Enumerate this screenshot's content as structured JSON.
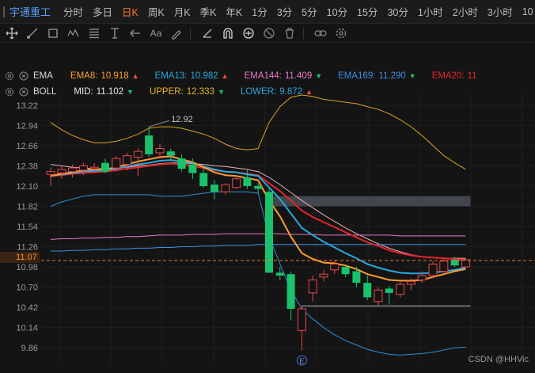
{
  "header": {
    "stock_name": "宇通重工",
    "tabs": [
      {
        "label": "分时",
        "active": false
      },
      {
        "label": "多日",
        "active": false
      },
      {
        "label": "日K",
        "active": true
      },
      {
        "label": "周K",
        "active": false
      },
      {
        "label": "月K",
        "active": false
      },
      {
        "label": "季K",
        "active": false
      },
      {
        "label": "年K",
        "active": false
      },
      {
        "label": "1分",
        "active": false
      },
      {
        "label": "3分",
        "active": false
      },
      {
        "label": "5分",
        "active": false
      },
      {
        "label": "10分",
        "active": false
      },
      {
        "label": "15分",
        "active": false
      },
      {
        "label": "30分",
        "active": false
      },
      {
        "label": "1小时",
        "active": false
      },
      {
        "label": "2小时",
        "active": false
      },
      {
        "label": "3小时",
        "active": false
      },
      {
        "label": "10",
        "active": false
      }
    ]
  },
  "toolbar": {
    "icons": [
      "move-icon",
      "line-icon",
      "rectangle-icon",
      "wave-icon",
      "fibonacci-icon",
      "text-level-icon",
      "arrow-icon",
      "text-icon",
      "brush-icon",
      "ruler-icon",
      "magnet-icon",
      "lock-icon",
      "hide-icon",
      "delete-icon",
      "link-icon",
      "settings-icon"
    ],
    "text_tool_label": "Aa"
  },
  "legend": {
    "ema": {
      "name": "EMA",
      "items": [
        {
          "label": "EMA8:",
          "value": "10.918",
          "dir": "up",
          "color": "#ff9d2e"
        },
        {
          "label": "EMA13:",
          "value": "10.982",
          "dir": "up",
          "color": "#29a8e0"
        },
        {
          "label": "EMA144:",
          "value": "11.409",
          "dir": "down",
          "color": "#e679c7"
        },
        {
          "label": "EMA169:",
          "value": "11.290",
          "dir": "down",
          "color": "#3d8ee6"
        },
        {
          "label": "EMA20:",
          "value": "11",
          "dir": "none",
          "color": "#e8242b"
        }
      ]
    },
    "boll": {
      "name": "BOLL",
      "items": [
        {
          "label": "MID:",
          "value": "11.102",
          "dir": "down",
          "color": "#e8e8e8"
        },
        {
          "label": "UPPER:",
          "value": "12.333",
          "dir": "down",
          "color": "#e8b422"
        },
        {
          "label": "LOWER:",
          "value": "9.872",
          "dir": "up",
          "color": "#29a8e0"
        }
      ]
    }
  },
  "colors": {
    "up": "#e8474b",
    "down": "#19c26b",
    "ema8": "#ff9d2e",
    "ema13": "#29a8e0",
    "ema144": "#e679c7",
    "ema169": "#3d8ee6",
    "ema20": "#e8242b",
    "boll_mid": "#e8b4b4",
    "boll_upper": "#d9a420",
    "boll_lower": "#2c8fd6"
  },
  "price_tag": "11.07",
  "watermark": "CSDN @HHVic",
  "chart_data": {
    "type": "candlestick",
    "y_ticks": [
      13.22,
      12.94,
      12.66,
      12.38,
      12.1,
      11.82,
      11.54,
      11.26,
      10.98,
      10.7,
      10.42,
      10.14,
      9.86
    ],
    "ylim": [
      9.72,
      13.36
    ],
    "current_price": 11.07,
    "high_label": "12.92",
    "event_marker": "E",
    "candles": [
      {
        "o": 12.26,
        "h": 12.36,
        "l": 12.1,
        "c": 12.3
      },
      {
        "o": 12.28,
        "h": 12.38,
        "l": 12.2,
        "c": 12.33
      },
      {
        "o": 12.3,
        "h": 12.4,
        "l": 12.22,
        "c": 12.35
      },
      {
        "o": 12.32,
        "h": 12.42,
        "l": 12.25,
        "c": 12.38
      },
      {
        "o": 12.34,
        "h": 12.42,
        "l": 12.28,
        "c": 12.36
      },
      {
        "o": 12.42,
        "h": 12.48,
        "l": 12.28,
        "c": 12.3
      },
      {
        "o": 12.35,
        "h": 12.52,
        "l": 12.3,
        "c": 12.48
      },
      {
        "o": 12.4,
        "h": 12.56,
        "l": 12.32,
        "c": 12.52
      },
      {
        "o": 12.5,
        "h": 12.62,
        "l": 12.24,
        "c": 12.58
      },
      {
        "o": 12.8,
        "h": 12.92,
        "l": 12.5,
        "c": 12.54
      },
      {
        "o": 12.56,
        "h": 12.68,
        "l": 12.48,
        "c": 12.62
      },
      {
        "o": 12.58,
        "h": 12.62,
        "l": 12.44,
        "c": 12.52
      },
      {
        "o": 12.48,
        "h": 12.54,
        "l": 12.3,
        "c": 12.34
      },
      {
        "o": 12.4,
        "h": 12.48,
        "l": 12.2,
        "c": 12.28
      },
      {
        "o": 12.28,
        "h": 12.34,
        "l": 12.08,
        "c": 12.1
      },
      {
        "o": 12.12,
        "h": 12.18,
        "l": 11.92,
        "c": 12.02
      },
      {
        "o": 12.02,
        "h": 12.14,
        "l": 11.98,
        "c": 12.12
      },
      {
        "o": 12.08,
        "h": 12.22,
        "l": 12.06,
        "c": 12.2
      },
      {
        "o": 12.22,
        "h": 12.32,
        "l": 12.06,
        "c": 12.1
      },
      {
        "o": 12.1,
        "h": 12.14,
        "l": 12.0,
        "c": 12.06
      },
      {
        "o": 12.02,
        "h": 12.08,
        "l": 10.9,
        "c": 10.9
      },
      {
        "o": 10.9,
        "h": 10.98,
        "l": 10.8,
        "c": 10.86
      },
      {
        "o": 10.88,
        "h": 10.92,
        "l": 10.24,
        "c": 10.4
      },
      {
        "o": 10.1,
        "h": 10.44,
        "l": 9.82,
        "c": 10.4
      },
      {
        "o": 10.62,
        "h": 10.86,
        "l": 10.5,
        "c": 10.8
      },
      {
        "o": 10.84,
        "h": 10.94,
        "l": 10.78,
        "c": 10.88
      },
      {
        "o": 10.94,
        "h": 11.08,
        "l": 10.88,
        "c": 11.02
      },
      {
        "o": 10.98,
        "h": 11.0,
        "l": 10.84,
        "c": 10.88
      },
      {
        "o": 10.92,
        "h": 10.98,
        "l": 10.7,
        "c": 10.76
      },
      {
        "o": 10.76,
        "h": 10.86,
        "l": 10.52,
        "c": 10.56
      },
      {
        "o": 10.5,
        "h": 10.7,
        "l": 10.44,
        "c": 10.66
      },
      {
        "o": 10.68,
        "h": 10.72,
        "l": 10.46,
        "c": 10.62
      },
      {
        "o": 10.6,
        "h": 10.78,
        "l": 10.56,
        "c": 10.74
      },
      {
        "o": 10.74,
        "h": 10.82,
        "l": 10.66,
        "c": 10.78
      },
      {
        "o": 10.8,
        "h": 10.92,
        "l": 10.76,
        "c": 10.86
      },
      {
        "o": 10.86,
        "h": 11.06,
        "l": 10.82,
        "c": 11.02
      },
      {
        "o": 10.92,
        "h": 11.1,
        "l": 10.88,
        "c": 11.06
      },
      {
        "o": 11.08,
        "h": 11.12,
        "l": 10.98,
        "c": 11.0
      },
      {
        "o": 10.98,
        "h": 11.1,
        "l": 10.96,
        "c": 11.08
      }
    ],
    "series": [
      {
        "name": "EMA8",
        "values": [
          12.24,
          12.27,
          12.29,
          12.32,
          12.33,
          12.33,
          12.36,
          12.4,
          12.44,
          12.47,
          12.5,
          12.51,
          12.47,
          12.43,
          12.36,
          12.29,
          12.25,
          12.24,
          12.21,
          12.18,
          11.9,
          11.68,
          11.4,
          11.17,
          11.09,
          11.04,
          11.03,
          11.0,
          10.95,
          10.88,
          10.84,
          10.8,
          10.79,
          10.79,
          10.8,
          10.84,
          10.88,
          10.92,
          10.95
        ]
      },
      {
        "name": "EMA13",
        "values": [
          12.24,
          12.26,
          12.28,
          12.3,
          12.31,
          12.32,
          12.34,
          12.37,
          12.4,
          12.42,
          12.45,
          12.46,
          12.44,
          12.42,
          12.37,
          12.33,
          12.3,
          12.29,
          12.26,
          12.24,
          12.08,
          11.92,
          11.72,
          11.52,
          11.42,
          11.33,
          11.25,
          11.17,
          11.1,
          11.02,
          10.97,
          10.93,
          10.9,
          10.89,
          10.89,
          10.9,
          10.92,
          10.94,
          10.97
        ]
      },
      {
        "name": "EMA20",
        "values": [
          12.24,
          12.25,
          12.27,
          12.28,
          12.29,
          12.3,
          12.32,
          12.34,
          12.36,
          12.38,
          12.4,
          12.41,
          12.4,
          12.38,
          12.35,
          12.32,
          12.3,
          12.29,
          12.27,
          12.25,
          12.14,
          12.03,
          11.9,
          11.76,
          11.67,
          11.6,
          11.53,
          11.46,
          11.39,
          11.32,
          11.27,
          11.21,
          11.17,
          11.14,
          11.12,
          11.11,
          11.1,
          11.09,
          11.08
        ]
      },
      {
        "name": "EMA144",
        "values": [
          11.36,
          11.37,
          11.37,
          11.38,
          11.38,
          11.39,
          11.39,
          11.4,
          11.4,
          11.41,
          11.42,
          11.42,
          11.42,
          11.43,
          11.43,
          11.43,
          11.44,
          11.44,
          11.44,
          11.44,
          11.44,
          11.44,
          11.43,
          11.43,
          11.43,
          11.42,
          11.42,
          11.42,
          11.42,
          11.42,
          11.42,
          11.42,
          11.41,
          11.41,
          11.41,
          11.41,
          11.41,
          11.41,
          11.41
        ]
      },
      {
        "name": "EMA169",
        "values": [
          11.2,
          11.2,
          11.21,
          11.21,
          11.22,
          11.22,
          11.23,
          11.23,
          11.24,
          11.24,
          11.25,
          11.25,
          11.26,
          11.26,
          11.27,
          11.27,
          11.28,
          11.28,
          11.28,
          11.29,
          11.29,
          11.29,
          11.29,
          11.29,
          11.29,
          11.29,
          11.29,
          11.29,
          11.29,
          11.29,
          11.29,
          11.29,
          11.29,
          11.29,
          11.29,
          11.29,
          11.29,
          11.29,
          11.29
        ]
      },
      {
        "name": "BOLL_MID",
        "values": [
          12.4,
          12.38,
          12.36,
          12.35,
          12.34,
          12.34,
          12.35,
          12.36,
          12.38,
          12.39,
          12.41,
          12.42,
          12.42,
          12.41,
          12.4,
          12.38,
          12.37,
          12.35,
          12.33,
          12.3,
          12.22,
          12.12,
          12.01,
          11.9,
          11.8,
          11.7,
          11.61,
          11.52,
          11.44,
          11.37,
          11.3,
          11.24,
          11.19,
          11.15,
          11.12,
          11.11,
          11.1,
          11.1,
          11.1
        ]
      },
      {
        "name": "BOLL_UPPER",
        "values": [
          12.98,
          12.88,
          12.8,
          12.74,
          12.7,
          12.7,
          12.72,
          12.76,
          12.82,
          12.9,
          12.92,
          12.92,
          12.9,
          12.86,
          12.82,
          12.76,
          12.68,
          12.62,
          12.6,
          12.62,
          12.98,
          13.2,
          13.33,
          13.36,
          13.34,
          13.3,
          13.28,
          13.26,
          13.24,
          13.2,
          13.16,
          13.1,
          13.02,
          12.92,
          12.8,
          12.66,
          12.52,
          12.42,
          12.33
        ]
      },
      {
        "name": "BOLL_LOWER",
        "values": [
          11.82,
          11.88,
          11.92,
          11.96,
          11.98,
          11.98,
          11.98,
          11.98,
          11.98,
          11.98,
          11.96,
          11.96,
          11.96,
          11.98,
          12.0,
          12.02,
          12.02,
          12.02,
          12.02,
          12.0,
          11.4,
          11.02,
          10.66,
          10.4,
          10.26,
          10.14,
          10.04,
          9.96,
          9.9,
          9.84,
          9.8,
          9.77,
          9.76,
          9.77,
          9.78,
          9.8,
          9.83,
          9.86,
          9.87
        ]
      }
    ],
    "zones": [
      {
        "from_index": 20,
        "to_index": 38,
        "y_low": 11.82,
        "y_high": 11.96,
        "color": "#4a4f57"
      }
    ],
    "support_line": {
      "from_index": 23,
      "to_index": 38,
      "y": 10.44
    }
  }
}
